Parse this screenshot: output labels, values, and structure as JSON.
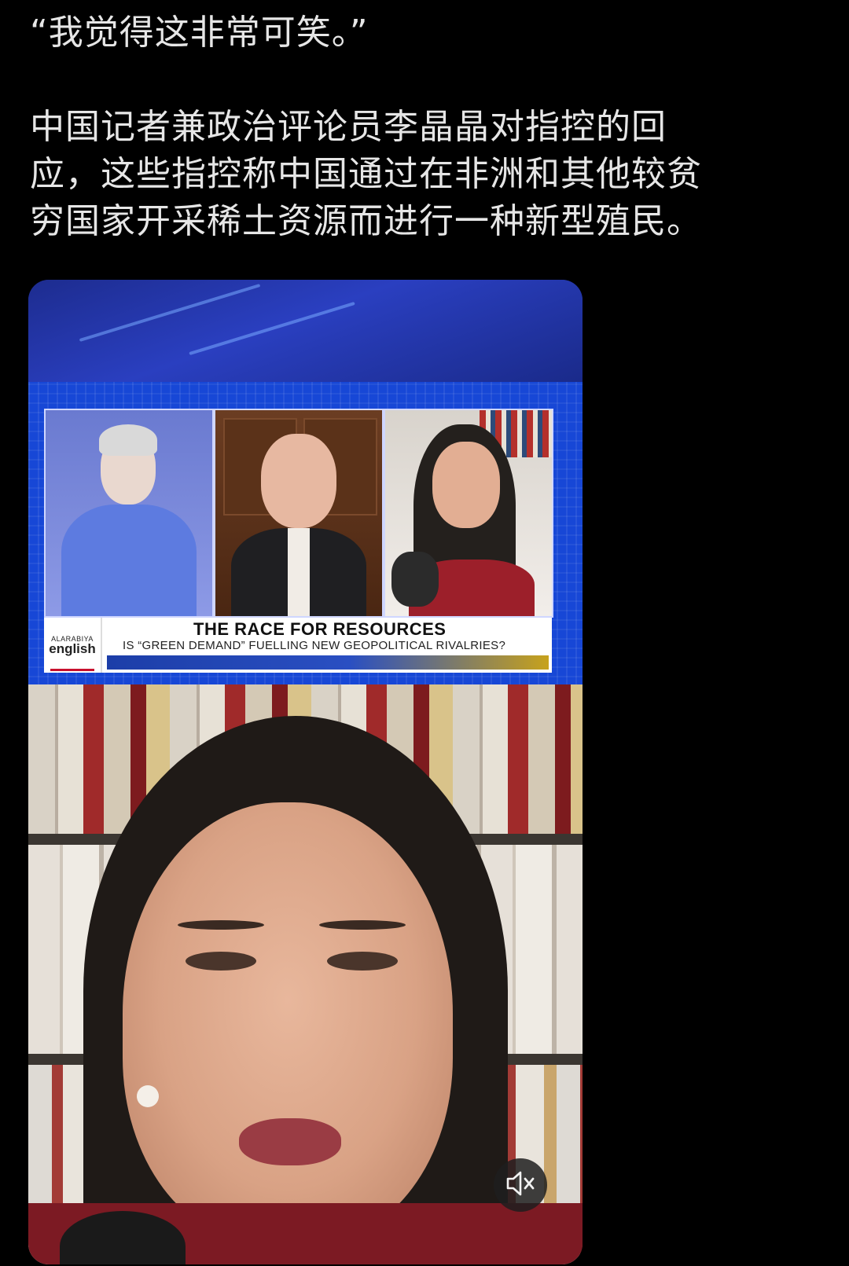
{
  "post": {
    "quote": "“我觉得这非常可笑。”",
    "body_lines": [
      "中国记者兼政治评论员李晶晶对指控的回",
      "应，这些指控称中国通过在非洲和其他较贫",
      "穷国家开采稀土资源而进行一种新型殖民。"
    ]
  },
  "broadcast": {
    "logo_top": "ALARABIYA",
    "logo_bottom": "english",
    "headline": "THE RACE FOR RESOURCES",
    "subheadline": "IS “GREEN DEMAND” FUELLING NEW GEOPOLITICAL RIVALRIES?"
  },
  "video_controls": {
    "mute_icon": "speaker-muted-icon",
    "muted": true
  },
  "colors": {
    "background": "#000000",
    "text": "#e6e6e6",
    "broadcast_blue": "#1d44d8",
    "brand_red": "#c8102e"
  }
}
